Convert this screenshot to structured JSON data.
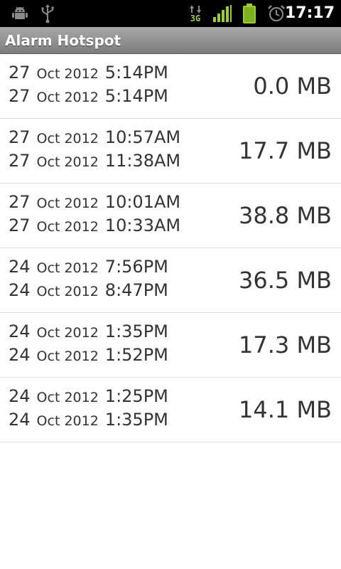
{
  "status_bar": {
    "clock": "17:17",
    "network_label": "3G",
    "icons": [
      "android-debug-icon",
      "usb-icon",
      "data-3g-icon",
      "signal-icon",
      "battery-icon",
      "alarm-clock-icon"
    ],
    "accent_color": "#9acd32"
  },
  "app": {
    "title": "Alarm Hotspot"
  },
  "sessions": [
    {
      "start": {
        "day": "27",
        "month": "Oct 2012",
        "time": "5:14PM"
      },
      "end": {
        "day": "27",
        "month": "Oct 2012",
        "time": "5:14PM"
      },
      "size": "0.0 MB"
    },
    {
      "start": {
        "day": "27",
        "month": "Oct 2012",
        "time": "10:57AM"
      },
      "end": {
        "day": "27",
        "month": "Oct 2012",
        "time": "11:38AM"
      },
      "size": "17.7 MB"
    },
    {
      "start": {
        "day": "27",
        "month": "Oct 2012",
        "time": "10:01AM"
      },
      "end": {
        "day": "27",
        "month": "Oct 2012",
        "time": "10:33AM"
      },
      "size": "38.8 MB"
    },
    {
      "start": {
        "day": "24",
        "month": "Oct 2012",
        "time": "7:56PM"
      },
      "end": {
        "day": "24",
        "month": "Oct 2012",
        "time": "8:47PM"
      },
      "size": "36.5 MB"
    },
    {
      "start": {
        "day": "24",
        "month": "Oct 2012",
        "time": "1:35PM"
      },
      "end": {
        "day": "24",
        "month": "Oct 2012",
        "time": "1:52PM"
      },
      "size": "17.3 MB"
    },
    {
      "start": {
        "day": "24",
        "month": "Oct 2012",
        "time": "1:25PM"
      },
      "end": {
        "day": "24",
        "month": "Oct 2012",
        "time": "1:35PM"
      },
      "size": "14.1 MB"
    }
  ]
}
